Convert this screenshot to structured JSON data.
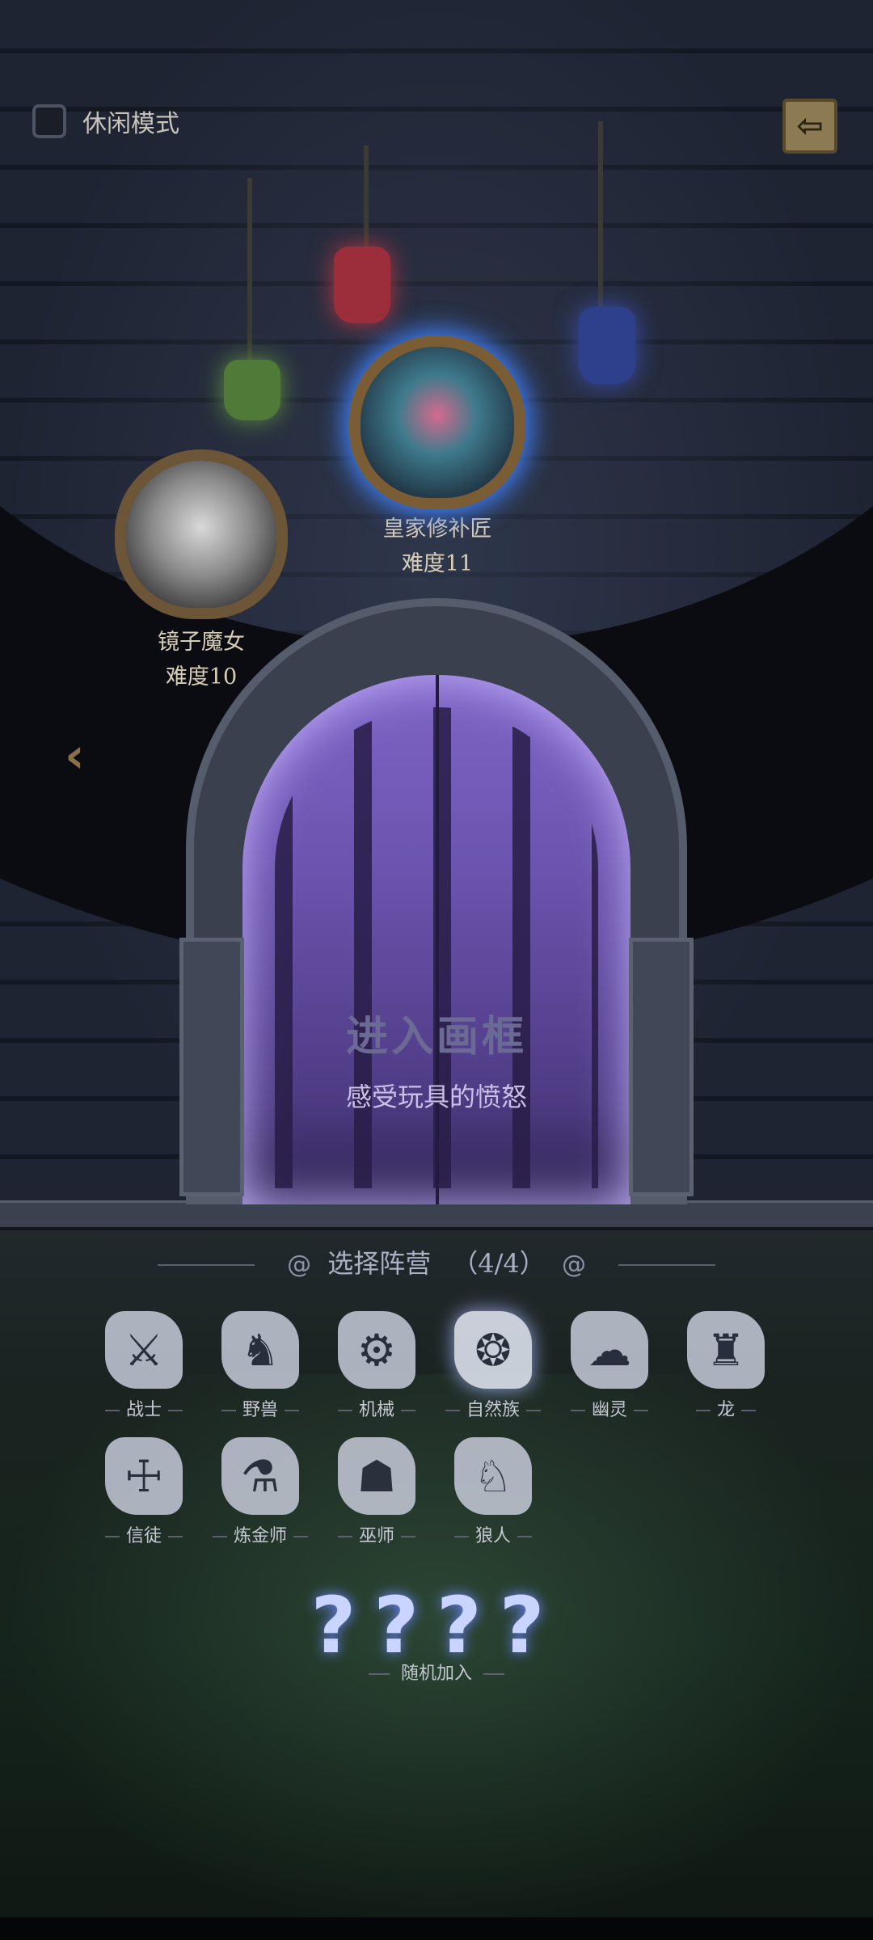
{
  "mode_toggle": {
    "label": "休闲模式",
    "checked": false
  },
  "exit_icon": "exit-arrow-icon",
  "portraits": [
    {
      "name": "镜子魔女",
      "difficulty": "难度10",
      "selected": false
    },
    {
      "name": "皇家修补匠",
      "difficulty": "难度11",
      "selected": true
    }
  ],
  "door": {
    "title": "进入画框",
    "subtitle": "感受玩具的愤怒"
  },
  "faction_select": {
    "title": "选择阵营",
    "count": "（4/4）",
    "factions": [
      {
        "label": "战士",
        "icon": "warrior-icon",
        "glyph": "⚔",
        "selected": false
      },
      {
        "label": "野兽",
        "icon": "beast-icon",
        "glyph": "♞",
        "selected": false
      },
      {
        "label": "机械",
        "icon": "wrench-icon",
        "glyph": "⚙",
        "selected": false
      },
      {
        "label": "自然族",
        "icon": "nature-swirl-icon",
        "glyph": "❂",
        "selected": true
      },
      {
        "label": "幽灵",
        "icon": "ghost-icon",
        "glyph": "☁",
        "selected": false
      },
      {
        "label": "龙",
        "icon": "dragon-icon",
        "glyph": "♜",
        "selected": false
      },
      {
        "label": "信徒",
        "icon": "praying-hands-icon",
        "glyph": "☩",
        "selected": false
      },
      {
        "label": "炼金师",
        "icon": "alchemy-flask-icon",
        "glyph": "⚗",
        "selected": false
      },
      {
        "label": "巫师",
        "icon": "wizard-hat-icon",
        "glyph": "☗",
        "selected": false
      },
      {
        "label": "狼人",
        "icon": "wolf-head-icon",
        "glyph": "♘",
        "selected": false
      }
    ],
    "random": {
      "marks": "????",
      "label": "随机加入"
    }
  },
  "colors": {
    "accent_glow": "#3e7cf0",
    "door_purple": "#7e64c5",
    "frame_brown": "#6d5537"
  }
}
